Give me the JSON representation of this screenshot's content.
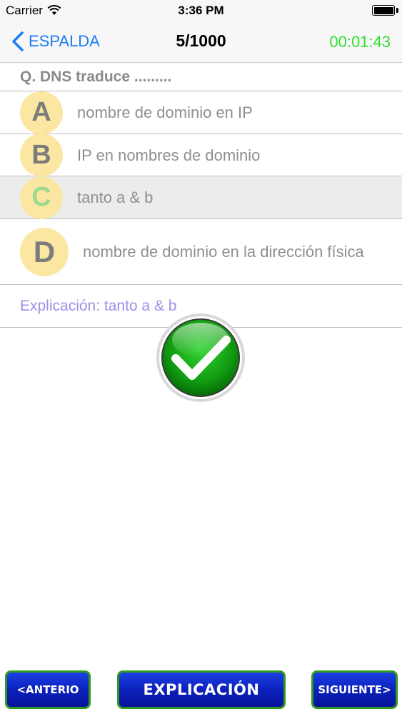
{
  "status_bar": {
    "carrier": "Carrier",
    "time": "3:36 PM"
  },
  "nav": {
    "back_label": "ESPALDA",
    "title": "5/1000",
    "timer": "00:01:43"
  },
  "question": {
    "text": "Q. DNS traduce ........."
  },
  "options": [
    {
      "letter": "A",
      "text": "nombre de dominio en IP",
      "selected": false
    },
    {
      "letter": "B",
      "text": "IP en nombres de dominio",
      "selected": false
    },
    {
      "letter": "C",
      "text": "tanto a & b",
      "selected": true,
      "correct": true
    },
    {
      "letter": "D",
      "text": "nombre de dominio en la dirección física",
      "selected": false
    }
  ],
  "explanation": {
    "text": "Explicación: tanto a & b"
  },
  "buttons": {
    "previous": "<ANTERIO",
    "explain": "EXPLICACIÓN",
    "next": "SIGUIENTE>"
  },
  "colors": {
    "accent_blue": "#1a7ef5",
    "timer_green": "#2fe02f",
    "badge_yellow": "#fbe6a2",
    "explanation_purple": "#a08ee8",
    "button_blue": "#0a1fb8",
    "button_border_green": "#2f9a1f"
  },
  "icons": {
    "back": "chevron-left-icon",
    "wifi": "wifi-icon",
    "battery": "battery-icon",
    "result": "check-mark-icon"
  }
}
